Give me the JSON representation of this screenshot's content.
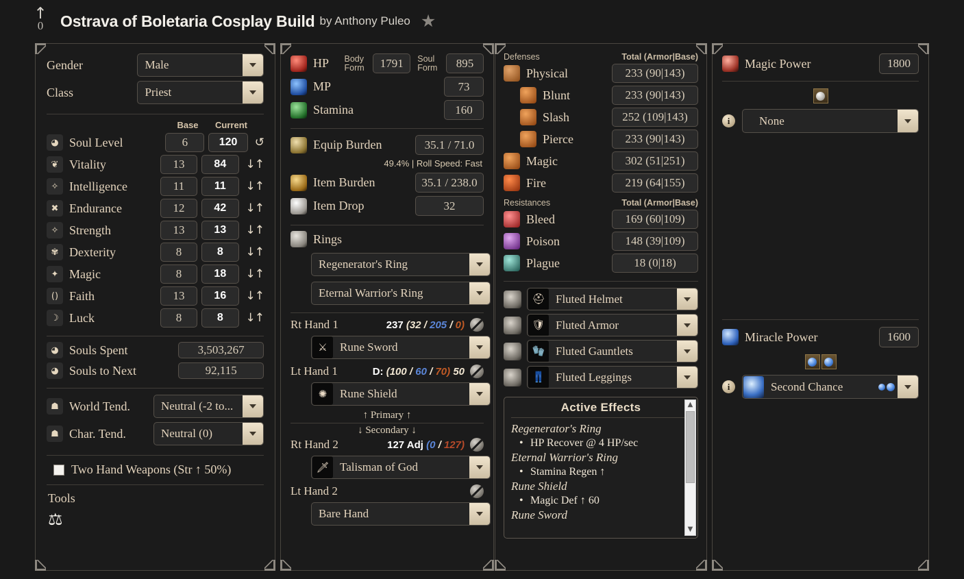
{
  "header": {
    "vote_count": "0",
    "vote_arrow": "↑",
    "title": "Ostrava of Boletaria Cosplay Build",
    "by_text": "by",
    "author": "Anthony Puleo",
    "star": "★"
  },
  "stats_panel": {
    "gender_label": "Gender",
    "gender_value": "Male",
    "class_label": "Class",
    "class_value": "Priest",
    "col_base": "Base",
    "col_current": "Current",
    "reset_icon": "↺",
    "down_up": "↓↑",
    "stats": [
      {
        "name": "Soul Level",
        "icon": "soul-level-icon",
        "base": "6",
        "current": "120",
        "control": "reset"
      },
      {
        "name": "Vitality",
        "icon": "vitality-icon",
        "base": "13",
        "current": "84",
        "control": "updown"
      },
      {
        "name": "Intelligence",
        "icon": "intelligence-icon",
        "base": "11",
        "current": "11",
        "control": "updown"
      },
      {
        "name": "Endurance",
        "icon": "endurance-icon",
        "base": "12",
        "current": "42",
        "control": "updown"
      },
      {
        "name": "Strength",
        "icon": "strength-icon",
        "base": "13",
        "current": "13",
        "control": "updown"
      },
      {
        "name": "Dexterity",
        "icon": "dexterity-icon",
        "base": "8",
        "current": "8",
        "control": "updown"
      },
      {
        "name": "Magic",
        "icon": "magic-icon",
        "base": "8",
        "current": "18",
        "control": "updown"
      },
      {
        "name": "Faith",
        "icon": "faith-icon",
        "base": "13",
        "current": "16",
        "control": "updown"
      },
      {
        "name": "Luck",
        "icon": "luck-icon",
        "base": "8",
        "current": "8",
        "control": "updown"
      }
    ],
    "souls_spent_label": "Souls Spent",
    "souls_spent_value": "3,503,267",
    "souls_next_label": "Souls to Next",
    "souls_next_value": "92,115",
    "world_tend_label": "World Tend.",
    "world_tend_value": "Neutral (-2 to...",
    "char_tend_label": "Char. Tend.",
    "char_tend_value": "Neutral (0)",
    "two_hand_label": "Two Hand Weapons (Str ↑ 50%)",
    "two_hand_checked": false,
    "tools_label": "Tools",
    "tools_icon": "scales-icon"
  },
  "vitals_panel": {
    "hp_label": "HP",
    "body_form_label": "Body Form",
    "body_form_value": "1791",
    "soul_form_label": "Soul Form",
    "soul_form_value": "895",
    "mp_label": "MP",
    "mp_value": "73",
    "stamina_label": "Stamina",
    "stamina_value": "160",
    "equip_burden_label": "Equip Burden",
    "equip_burden_value": "35.1 / 71.0",
    "burden_detail": "49.4% | Roll Speed: Fast",
    "item_burden_label": "Item Burden",
    "item_burden_value": "35.1 / 238.0",
    "item_drop_label": "Item Drop",
    "item_drop_value": "32",
    "rings_label": "Rings",
    "rings": [
      "Regenerator's Ring",
      "Eternal Warrior's Ring"
    ],
    "rt_hand_1_label": "Rt Hand 1",
    "rt_hand_1_total": "237",
    "rt_hand_1_phys": "(32",
    "rt_hand_1_sep1": "/",
    "rt_hand_1_magic": "205",
    "rt_hand_1_sep2": "/",
    "rt_hand_1_fire": "0)",
    "rt_hand_1_item": "Rune Sword",
    "lt_hand_1_label": "Lt Hand 1",
    "lt_hand_1_prefix": "D:",
    "lt_hand_1_phys": "(100",
    "lt_hand_1_sep1": "/",
    "lt_hand_1_magic": "60",
    "lt_hand_1_sep2": "/",
    "lt_hand_1_fire": "70)",
    "lt_hand_1_suffix": "50",
    "lt_hand_1_item": "Rune Shield",
    "primary_label": "↑ Primary ↑",
    "secondary_label": "↓ Secondary ↓",
    "rt_hand_2_label": "Rt Hand 2",
    "rt_hand_2_total": "127 Adj",
    "rt_hand_2_magic": "(0",
    "rt_hand_2_sep": "/",
    "rt_hand_2_fire": "127)",
    "rt_hand_2_item": "Talisman of God",
    "lt_hand_2_label": "Lt Hand 2",
    "lt_hand_2_item": "Bare Hand"
  },
  "defense_panel": {
    "defenses_label": "Defenses",
    "defenses_col": "Total (Armor|Base)",
    "defenses": [
      {
        "name": "Physical",
        "value": "233 (90|143)",
        "indent": 0,
        "icon": "physical-icon"
      },
      {
        "name": "Blunt",
        "value": "233 (90|143)",
        "indent": 1,
        "icon": "blunt-icon"
      },
      {
        "name": "Slash",
        "value": "252 (109|143)",
        "indent": 1,
        "icon": "slash-icon"
      },
      {
        "name": "Pierce",
        "value": "233 (90|143)",
        "indent": 1,
        "icon": "pierce-icon"
      },
      {
        "name": "Magic",
        "value": "302 (51|251)",
        "indent": 0,
        "icon": "magic-def-icon"
      },
      {
        "name": "Fire",
        "value": "219 (64|155)",
        "indent": 0,
        "icon": "fire-icon"
      }
    ],
    "resistances_label": "Resistances",
    "resistances_col": "Total (Armor|Base)",
    "resistances": [
      {
        "name": "Bleed",
        "value": "169 (60|109)",
        "icon": "bleed-icon"
      },
      {
        "name": "Poison",
        "value": "148 (39|109)",
        "icon": "poison-icon"
      },
      {
        "name": "Plague",
        "value": "18 (0|18)",
        "icon": "plague-icon"
      }
    ],
    "armor": [
      {
        "name": "Fluted Helmet",
        "icon": "helmet-icon"
      },
      {
        "name": "Fluted Armor",
        "icon": "chest-icon"
      },
      {
        "name": "Fluted Gauntlets",
        "icon": "gauntlet-icon"
      },
      {
        "name": "Fluted Leggings",
        "icon": "leggings-icon"
      }
    ],
    "effects_title": "Active Effects",
    "effects": [
      {
        "source": "Regenerator's Ring",
        "items": [
          "HP Recover @ 4 HP/sec"
        ]
      },
      {
        "source": "Eternal Warrior's Ring",
        "items": [
          "Stamina Regen ↑"
        ]
      },
      {
        "source": "Rune Shield",
        "items": [
          "Magic Def ↑ 60"
        ]
      },
      {
        "source": "Rune Sword",
        "items": []
      }
    ]
  },
  "magic_panel": {
    "magic_power_label": "Magic Power",
    "magic_power_value": "1800",
    "magic_slots": 1,
    "magic_spell": "None",
    "miracle_power_label": "Miracle Power",
    "miracle_power_value": "1600",
    "miracle_slots": 2,
    "miracle_spell": "Second Chance"
  },
  "colors": {
    "background": "#191919",
    "panel_bg": "#1b1b1b",
    "border": "#4a4640",
    "text": "#e4d4bd",
    "accent_cream": "#f0e4cd",
    "magic_blue": "#5b86d8",
    "fire_red": "#b64a2a"
  }
}
